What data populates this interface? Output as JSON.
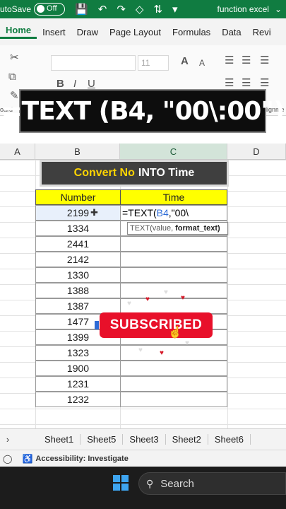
{
  "titlebar": {
    "autosave_label": "utoSave",
    "toggle_state": "Off",
    "file_title": "function excel"
  },
  "ribbon": {
    "tabs": [
      "Home",
      "Insert",
      "Draw",
      "Page Layout",
      "Formulas",
      "Data",
      "Revi"
    ],
    "font_size": "11",
    "left_label": "oard",
    "right_label": "lignme"
  },
  "banner": {
    "formula_text": "=TEXT (B4, \"00\\:00\")"
  },
  "grid": {
    "columns": [
      "A",
      "B",
      "C",
      "D"
    ]
  },
  "convert_label": {
    "part_yellow": "Convert No",
    "part_white": "INTO Time"
  },
  "table": {
    "header_number": "Number",
    "header_time": "Time",
    "numbers": [
      "2199",
      "1334",
      "2441",
      "2142",
      "1330",
      "1388",
      "1387",
      "1477",
      "1399",
      "1323",
      "1900",
      "1231",
      "1232"
    ],
    "formula_prefix": "=TEXT(",
    "formula_ref": "B4",
    "formula_suffix": ",\"00\\",
    "tooltip_args": "TEXT(value,",
    "tooltip_bold": "format_text)"
  },
  "overlay": {
    "subscribed": "SUBSCRIBED"
  },
  "sheets": [
    "Sheet1",
    "Sheet5",
    "Sheet3",
    "Sheet2",
    "Sheet6"
  ],
  "statusbar": {
    "accessibility": "Accessibility: Investigate"
  },
  "taskbar": {
    "search_label": "Search"
  },
  "colors": {
    "excel_green": "#107c41",
    "header_yellow": "#ffff00",
    "subscribe_red": "#e8102a",
    "ref_blue": "#2d6bd6"
  }
}
